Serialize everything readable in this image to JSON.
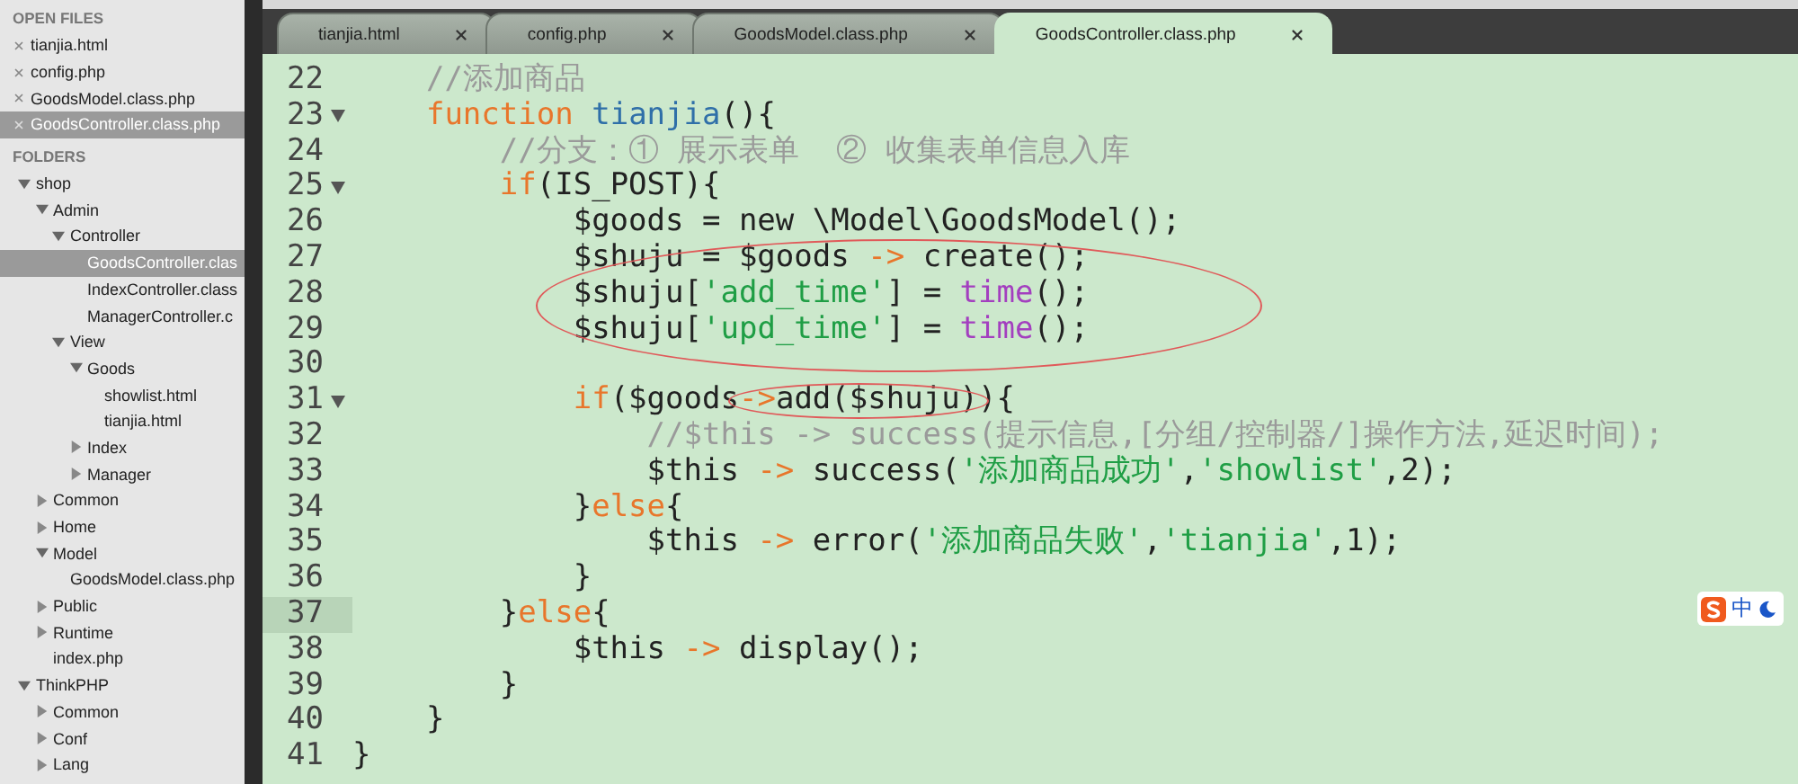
{
  "sidebar": {
    "open_files_heading": "OPEN FILES",
    "open_files": [
      {
        "name": "tianjia.html",
        "selected": false
      },
      {
        "name": "config.php",
        "selected": false
      },
      {
        "name": "GoodsModel.class.php",
        "selected": false
      },
      {
        "name": "GoodsController.class.php",
        "selected": true
      }
    ],
    "folders_heading": "FOLDERS",
    "tree": [
      {
        "name": "shop",
        "expanded": true,
        "children": [
          {
            "name": "Admin",
            "expanded": true,
            "children": [
              {
                "name": "Controller",
                "expanded": true,
                "children": [
                  {
                    "name": "GoodsController.clas",
                    "selected": true
                  },
                  {
                    "name": "IndexController.class",
                    "selected": false
                  },
                  {
                    "name": "ManagerController.c",
                    "selected": false
                  }
                ]
              },
              {
                "name": "View",
                "expanded": true,
                "children": [
                  {
                    "name": "Goods",
                    "expanded": true,
                    "children": [
                      {
                        "name": "showlist.html",
                        "selected": false
                      },
                      {
                        "name": "tianjia.html",
                        "selected": false
                      }
                    ]
                  },
                  {
                    "name": "Index",
                    "expanded": false
                  },
                  {
                    "name": "Manager",
                    "expanded": false
                  }
                ]
              }
            ]
          },
          {
            "name": "Common",
            "expanded": false
          },
          {
            "name": "Home",
            "expanded": false
          },
          {
            "name": "Model",
            "expanded": true,
            "children": [
              {
                "name": "GoodsModel.class.php",
                "selected": false
              }
            ]
          },
          {
            "name": "Public",
            "expanded": false
          },
          {
            "name": "Runtime",
            "expanded": false
          },
          {
            "name": "index.php",
            "selected": false
          }
        ]
      },
      {
        "name": "ThinkPHP",
        "expanded": true,
        "children": [
          {
            "name": "Common",
            "expanded": false
          },
          {
            "name": "Conf",
            "expanded": false
          },
          {
            "name": "Lang",
            "expanded": false
          }
        ]
      }
    ]
  },
  "tabs": [
    {
      "label": "tianjia.html",
      "selected": false
    },
    {
      "label": "config.php",
      "selected": false
    },
    {
      "label": "GoodsModel.class.php",
      "selected": false
    },
    {
      "label": "GoodsController.class.php",
      "selected": true
    }
  ],
  "editor": {
    "lines": [
      {
        "number": "22",
        "tokens": [
          {
            "kind": "comment",
            "text": "    //添加商品"
          }
        ]
      },
      {
        "number": "23",
        "foldable": true,
        "tokens": [
          {
            "kind": "keyword",
            "text": "    function"
          },
          {
            "kind": "name",
            "text": " tianjia"
          },
          {
            "kind": "plain",
            "text": "(){"
          }
        ]
      },
      {
        "number": "24",
        "tokens": [
          {
            "kind": "comment",
            "text": "        //分支：① 展示表单  ② 收集表单信息入库"
          }
        ]
      },
      {
        "number": "25",
        "foldable": true,
        "tokens": [
          {
            "kind": "keyword",
            "text": "        if"
          },
          {
            "kind": "plain",
            "text": "(IS_POST){"
          }
        ]
      },
      {
        "number": "26",
        "tokens": [
          {
            "kind": "plain",
            "text": "            $goods = new \\Model\\GoodsModel();"
          }
        ]
      },
      {
        "number": "27",
        "circled": true,
        "tokens": [
          {
            "kind": "plain",
            "text": "            $shuju = $goods "
          },
          {
            "kind": "operator",
            "text": "->"
          },
          {
            "kind": "plain",
            "text": " create();"
          }
        ]
      },
      {
        "number": "28",
        "circled": true,
        "tokens": [
          {
            "kind": "plain",
            "text": "            $shuju["
          },
          {
            "kind": "string",
            "text": "'add_time'"
          },
          {
            "kind": "plain",
            "text": "] = "
          },
          {
            "kind": "builtin",
            "text": "time"
          },
          {
            "kind": "plain",
            "text": "();"
          }
        ]
      },
      {
        "number": "29",
        "circled": true,
        "tokens": [
          {
            "kind": "plain",
            "text": "            $shuju["
          },
          {
            "kind": "string",
            "text": "'upd_time'"
          },
          {
            "kind": "plain",
            "text": "] = "
          },
          {
            "kind": "builtin",
            "text": "time"
          },
          {
            "kind": "plain",
            "text": "();"
          }
        ]
      },
      {
        "number": "30"
      },
      {
        "number": "31",
        "foldable": true,
        "tokens": [
          {
            "kind": "keyword",
            "text": "            if"
          },
          {
            "kind": "plain",
            "text": "($goods"
          },
          {
            "kind": "operator",
            "text": "->",
            "circled": true
          },
          {
            "kind": "plain",
            "text": "add($shuju)",
            "circled": true
          },
          {
            "kind": "plain",
            "text": "){"
          }
        ]
      },
      {
        "number": "32",
        "tokens": [
          {
            "kind": "comment",
            "text": "                //$this -> success(提示信息,[分组/控制器/]操作方法,延迟时间);"
          }
        ]
      },
      {
        "number": "33",
        "tokens": [
          {
            "kind": "plain",
            "text": "                $this "
          },
          {
            "kind": "operator",
            "text": "->"
          },
          {
            "kind": "plain",
            "text": " success("
          },
          {
            "kind": "string",
            "text": "'添加商品成功'"
          },
          {
            "kind": "plain",
            "text": ","
          },
          {
            "kind": "string",
            "text": "'showlist'"
          },
          {
            "kind": "plain",
            "text": ",2);"
          }
        ]
      },
      {
        "number": "34",
        "tokens": [
          {
            "kind": "plain",
            "text": "            }"
          },
          {
            "kind": "keyword",
            "text": "else"
          },
          {
            "kind": "plain",
            "text": "{"
          }
        ]
      },
      {
        "number": "35",
        "tokens": [
          {
            "kind": "plain",
            "text": "                $this "
          },
          {
            "kind": "operator",
            "text": "->"
          },
          {
            "kind": "plain",
            "text": " error("
          },
          {
            "kind": "string",
            "text": "'添加商品失败'"
          },
          {
            "kind": "plain",
            "text": ","
          },
          {
            "kind": "string",
            "text": "'tianjia'"
          },
          {
            "kind": "plain",
            "text": ",1);"
          }
        ]
      },
      {
        "number": "36",
        "tokens": [
          {
            "kind": "plain",
            "text": "            }"
          }
        ]
      },
      {
        "number": "37",
        "current": true,
        "tokens": [
          {
            "kind": "plain",
            "text": "        }"
          },
          {
            "kind": "keyword",
            "text": "else"
          },
          {
            "kind": "plain",
            "text": "{"
          }
        ]
      },
      {
        "number": "38",
        "tokens": [
          {
            "kind": "plain",
            "text": "            $this "
          },
          {
            "kind": "operator",
            "text": "->"
          },
          {
            "kind": "plain",
            "text": " display();"
          }
        ]
      },
      {
        "number": "39",
        "tokens": [
          {
            "kind": "plain",
            "text": "        }"
          }
        ]
      },
      {
        "number": "40",
        "tokens": [
          {
            "kind": "plain",
            "text": "    }"
          }
        ]
      },
      {
        "number": "41",
        "tokens": [
          {
            "kind": "plain",
            "text": "}"
          }
        ]
      }
    ]
  },
  "ime_indicator": {
    "label": "中"
  }
}
